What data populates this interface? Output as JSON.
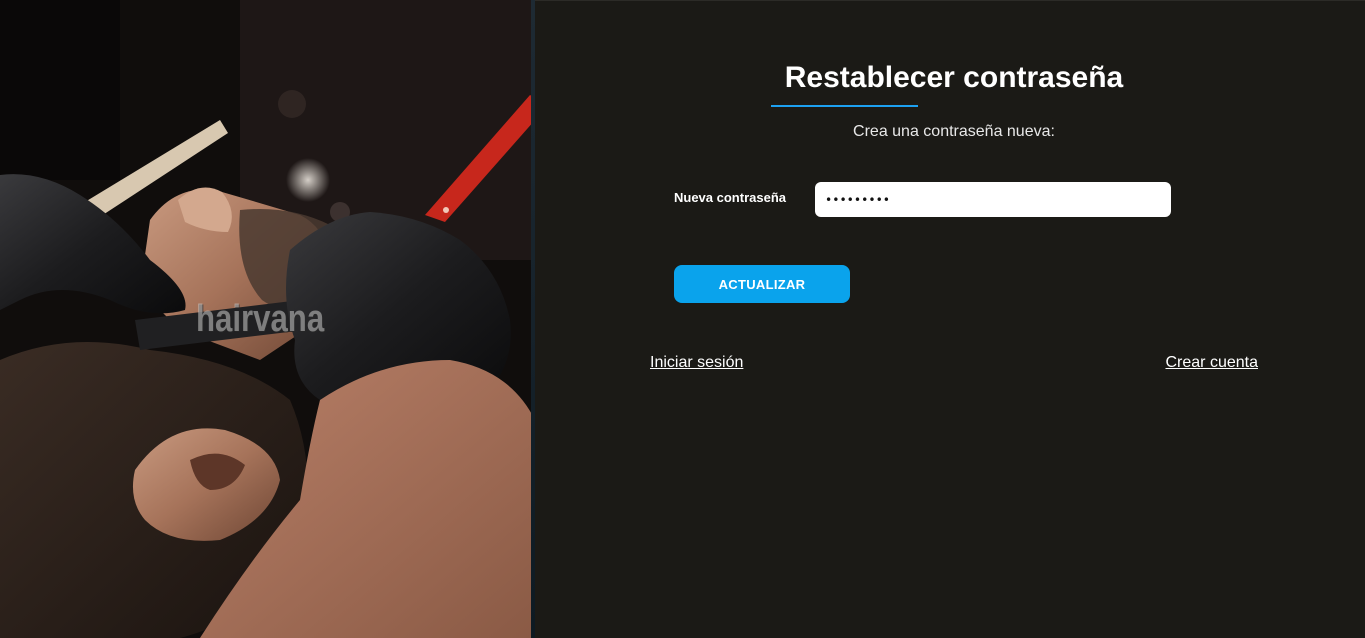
{
  "hero": {
    "watermark": "hairvana",
    "photo": "barber-shaving-beard-photo"
  },
  "form": {
    "title": "Restablecer contraseña",
    "subtitle": "Crea una contraseña nueva:",
    "password_label": "Nueva contraseña",
    "password_value": "•••••••••",
    "submit_label": "ACTUALIZAR"
  },
  "links": {
    "login": "Iniciar sesión",
    "register": "Crear cuenta"
  },
  "colors": {
    "background": "#1b1a16",
    "accent": "#0aa3ec",
    "underline": "#1da1f2",
    "text": "#ffffff"
  }
}
